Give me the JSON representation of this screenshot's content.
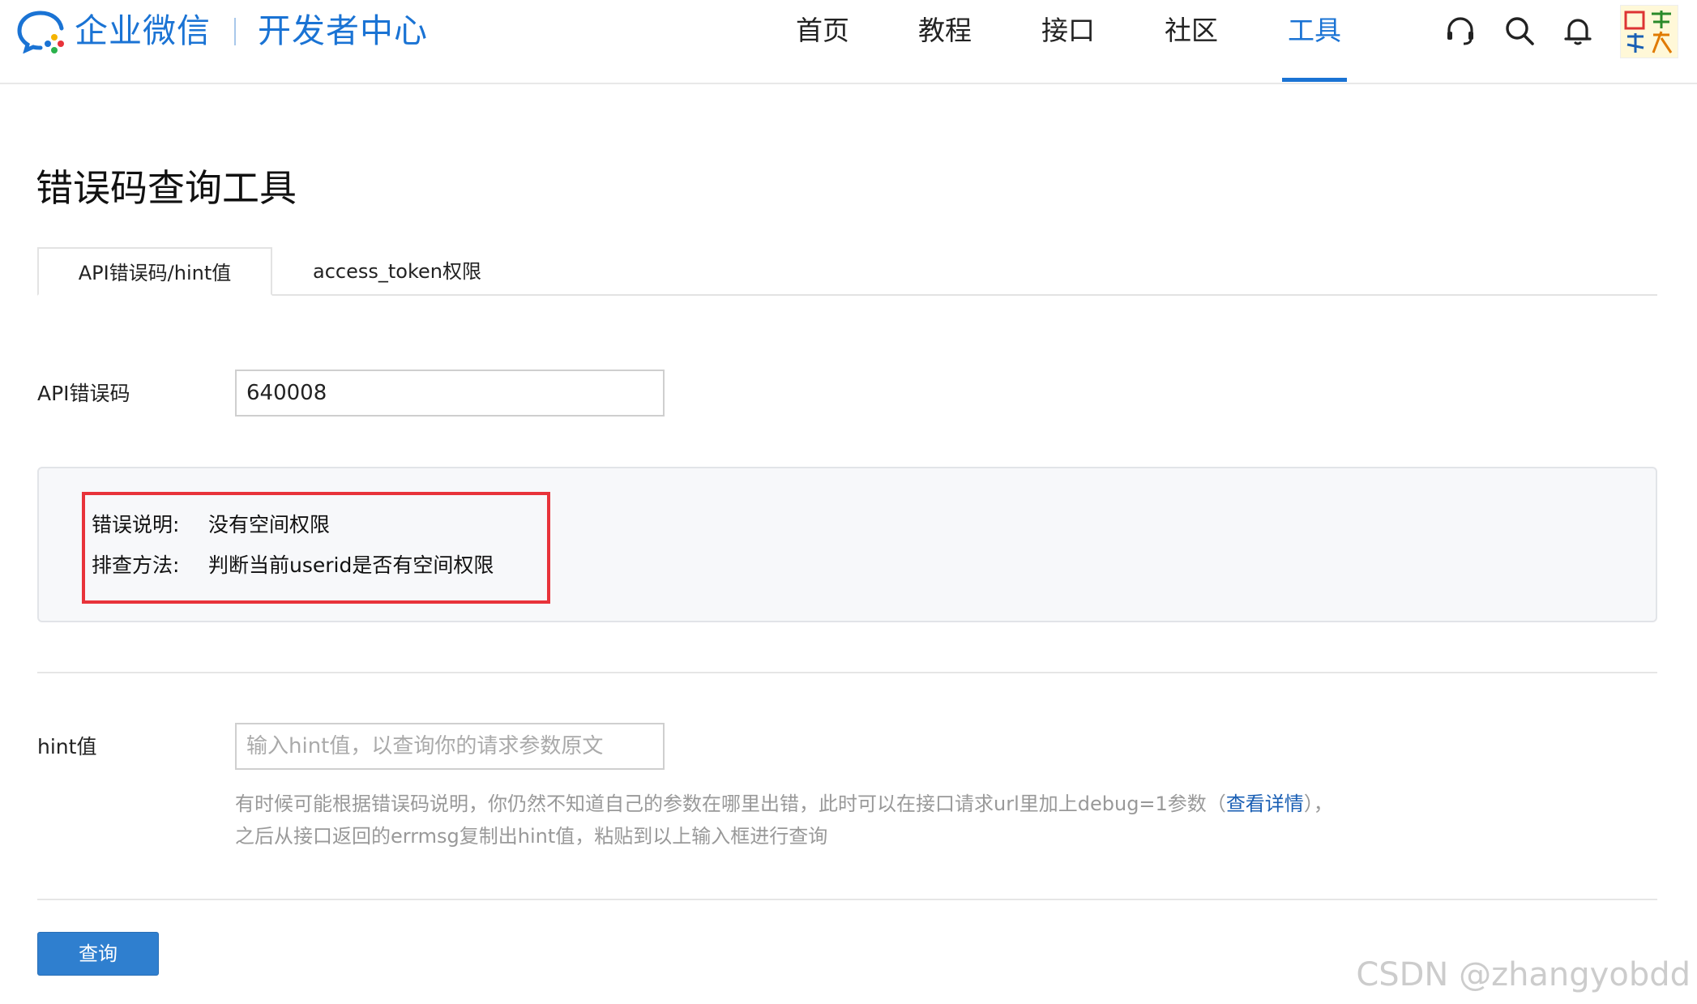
{
  "header": {
    "brand": "企业微信",
    "subbrand": "开发者中心",
    "nav": [
      "首页",
      "教程",
      "接口",
      "社区",
      "工具"
    ],
    "active_nav": "工具",
    "icons": [
      "headset-icon",
      "search-icon",
      "bell-icon",
      "avatar"
    ]
  },
  "page": {
    "title": "错误码查询工具"
  },
  "tabs": [
    {
      "label": "API错误码/hint值",
      "active": true
    },
    {
      "label": "access_token权限",
      "active": false
    }
  ],
  "api_code": {
    "label": "API错误码",
    "value": "640008"
  },
  "result": {
    "desc_key": "错误说明:",
    "desc_value": "没有空间权限",
    "method_key": "排查方法:",
    "method_value": "判断当前userid是否有空间权限"
  },
  "hint": {
    "label": "hint值",
    "placeholder": "输入hint值，以查询你的请求参数原文",
    "help_line1_pre": "有时候可能根据错误码说明，你仍然不知道自己的参数在哪里出错，此时可以在接口请求url里加上debug=1参数（",
    "help_link": "查看详情",
    "help_line1_post": "），",
    "help_line2": "之后从接口返回的errmsg复制出hint值，粘贴到以上输入框进行查询"
  },
  "submit_label": "查询",
  "watermark": "CSDN @zhangyobdd",
  "colors": {
    "brand": "#1a73d4",
    "button": "#2f7fcf",
    "highlight_border": "#e8333a"
  }
}
